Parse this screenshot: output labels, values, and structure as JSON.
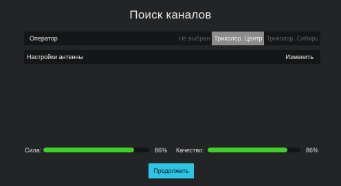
{
  "title": "Поиск каналов",
  "operator": {
    "label": "Оператор",
    "options": [
      "Не выбран",
      "Триколор. Центр",
      "Триколор. Сибирь"
    ],
    "selected": "Триколор. Центр"
  },
  "antenna": {
    "label": "Настройки антенны",
    "action": "Изменить"
  },
  "signal": {
    "strength_label": "Сила:",
    "strength_value": "86%",
    "strength_fraction": 0.86,
    "quality_label": "Качество:",
    "quality_value": "86%",
    "quality_fraction": 0.86
  },
  "continue_label": "Продолжить",
  "colors": {
    "background": "#222426",
    "bar_fill": "#3fd12a",
    "button": "#2ec4e6",
    "selected_option": "#8c8c8c"
  }
}
